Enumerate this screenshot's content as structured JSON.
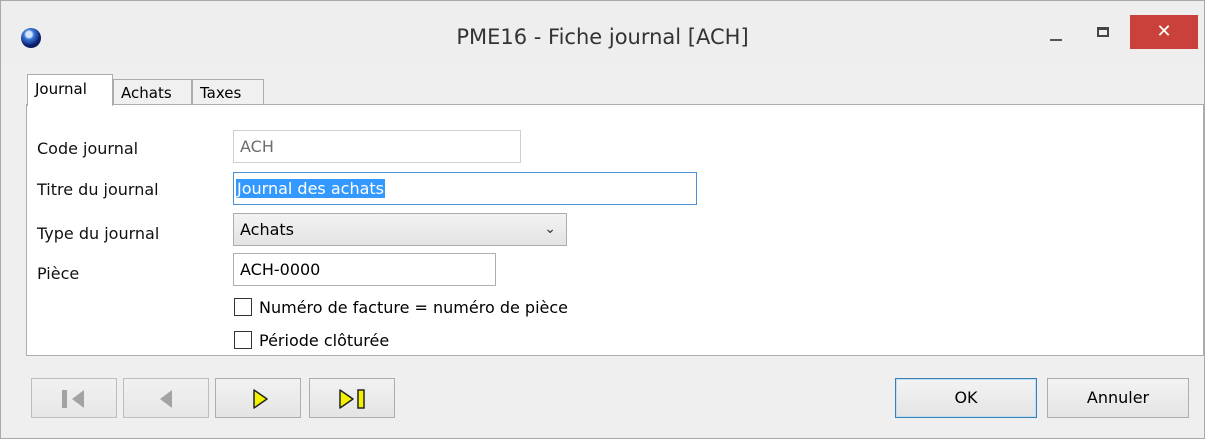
{
  "window": {
    "title": "PME16 - Fiche journal [ACH]",
    "controls": {
      "minimize": "minimize",
      "maximize": "maximize",
      "close": "✕"
    }
  },
  "tabs": [
    {
      "label": "Journal",
      "active": true
    },
    {
      "label": "Achats",
      "active": false
    },
    {
      "label": "Taxes",
      "active": false
    }
  ],
  "form": {
    "code_label": "Code journal",
    "code_value": "ACH",
    "titre_label": "Titre du journal",
    "titre_value": "Journal des achats",
    "type_label": "Type du journal",
    "type_value": "Achats",
    "piece_label": "Pièce",
    "piece_value": "ACH-0000",
    "check_facture_label": "Numéro de facture = numéro de pièce",
    "check_facture_checked": false,
    "check_periode_label": "Période clôturée",
    "check_periode_checked": false
  },
  "nav": {
    "first": {
      "icon": "first-record-icon",
      "enabled": false
    },
    "prev": {
      "icon": "previous-record-icon",
      "enabled": false
    },
    "next": {
      "icon": "next-record-icon",
      "enabled": true
    },
    "last": {
      "icon": "last-record-icon",
      "enabled": true
    }
  },
  "buttons": {
    "ok": "OK",
    "cancel": "Annuler"
  },
  "colors": {
    "close_button": "#c9413a",
    "selection": "#3399ff",
    "nav_active_arrow": "#f2f200",
    "nav_disabled_arrow": "#8a8a8a"
  }
}
